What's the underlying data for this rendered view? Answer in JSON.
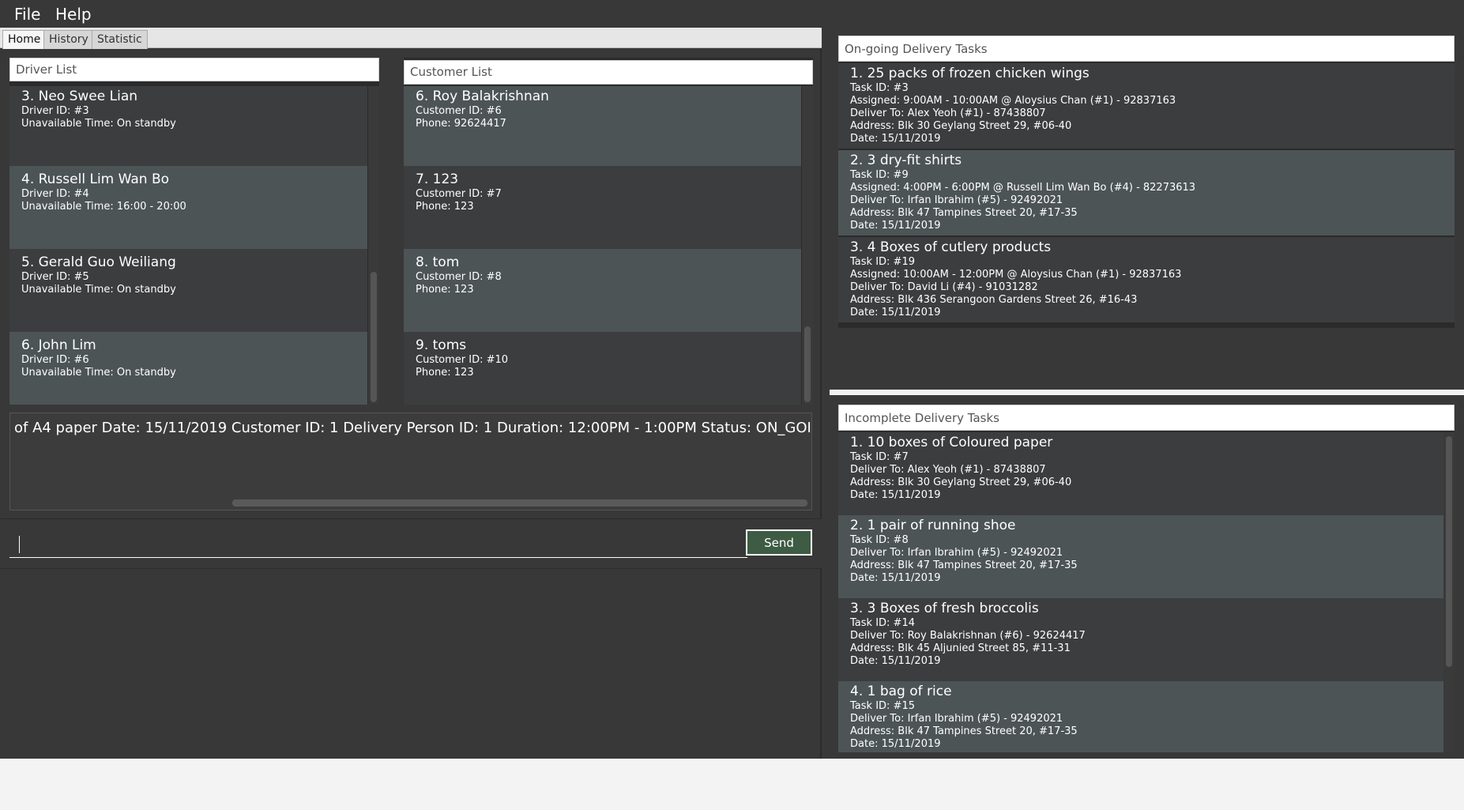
{
  "menu": {
    "file": "File",
    "help": "Help"
  },
  "tabs": {
    "home": "Home",
    "history": "History",
    "statistic": "Statistic"
  },
  "driver_list": {
    "header": "Driver List",
    "items": [
      {
        "title": "3.  Neo Swee Lian",
        "id": "Driver ID: #3",
        "detail": "Unavailable Time: On standby"
      },
      {
        "title": "4.  Russell Lim Wan Bo",
        "id": "Driver ID: #4",
        "detail": "Unavailable Time: 16:00 - 20:00"
      },
      {
        "title": "5.  Gerald Guo Weiliang",
        "id": "Driver ID: #5",
        "detail": "Unavailable Time: On standby"
      },
      {
        "title": "6.  John Lim",
        "id": "Driver ID: #6",
        "detail": "Unavailable Time: On standby"
      }
    ]
  },
  "customer_list": {
    "header": "Customer List",
    "items": [
      {
        "title": "6.  Roy Balakrishnan",
        "id": "Customer ID: #6",
        "detail": "Phone: 92624417"
      },
      {
        "title": "7.  123",
        "id": "Customer ID: #7",
        "detail": "Phone: 123"
      },
      {
        "title": "8.  tom",
        "id": "Customer ID: #8",
        "detail": "Phone: 123"
      },
      {
        "title": "9.  toms",
        "id": "Customer ID: #10",
        "detail": "Phone: 123"
      }
    ]
  },
  "result_display": "of A4 paper Date: 15/11/2019 Customer ID: 1 Delivery Person ID: 1 Duration: 12:00PM - 1:00PM Status: ON_GOING",
  "command_box": {
    "value": "",
    "send_label": "Send"
  },
  "ongoing_tasks": {
    "header": "On-going Delivery Tasks",
    "items": [
      {
        "title": "1.  25 packs of frozen chicken wings",
        "lines": [
          "Task ID: #3",
          "Assigned: 9:00AM - 10:00AM @ Aloysius Chan (#1) - 92837163",
          "Deliver To: Alex Yeoh (#1) - 87438807",
          "Address: Blk 30 Geylang Street 29, #06-40",
          "Date: 15/11/2019"
        ]
      },
      {
        "title": "2.  3 dry-fit shirts",
        "lines": [
          "Task ID: #9",
          "Assigned: 4:00PM - 6:00PM @ Russell Lim Wan Bo (#4) - 82273613",
          "Deliver To: Irfan Ibrahim (#5) - 92492021",
          "Address: Blk 47 Tampines Street 20, #17-35",
          "Date: 15/11/2019"
        ]
      },
      {
        "title": "3.  4 Boxes of cutlery products",
        "lines": [
          "Task ID: #19",
          "Assigned: 10:00AM - 12:00PM @ Aloysius Chan (#1) - 92837163",
          "Deliver To: David Li (#4) - 91031282",
          "Address: Blk 436 Serangoon Gardens Street 26, #16-43",
          "Date: 15/11/2019"
        ]
      }
    ]
  },
  "incomplete_tasks": {
    "header": "Incomplete Delivery Tasks",
    "items": [
      {
        "title": "1.  10 boxes of Coloured paper",
        "lines": [
          "Task ID: #7",
          "Deliver To: Alex Yeoh (#1) - 87438807",
          "Address: Blk 30 Geylang Street 29, #06-40",
          "Date: 15/11/2019"
        ]
      },
      {
        "title": "2.  1 pair of running shoe",
        "lines": [
          "Task ID: #8",
          "Deliver To: Irfan Ibrahim (#5) - 92492021",
          "Address: Blk 47 Tampines Street 20, #17-35",
          "Date: 15/11/2019"
        ]
      },
      {
        "title": "3.  3 Boxes of fresh broccolis",
        "lines": [
          "Task ID: #14",
          "Deliver To: Roy Balakrishnan (#6) - 92624417",
          "Address: Blk 45 Aljunied Street 85, #11-31",
          "Date: 15/11/2019"
        ]
      },
      {
        "title": "4.  1 bag of rice",
        "lines": [
          "Task ID: #15",
          "Deliver To: Irfan Ibrahim (#5) - 92492021",
          "Address: Blk 47 Tampines Street 20, #17-35",
          "Date: 15/11/2019"
        ]
      }
    ]
  }
}
